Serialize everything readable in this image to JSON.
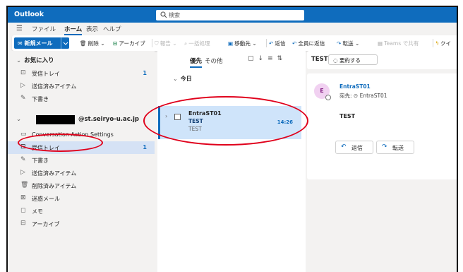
{
  "app": {
    "name": "Outlook"
  },
  "search": {
    "placeholder": "検索"
  },
  "menu": {
    "tabs": [
      {
        "label": "ファイル"
      },
      {
        "label": "ホーム"
      },
      {
        "label": "表示"
      },
      {
        "label": "ヘルプ"
      }
    ],
    "active_tab": "ホーム"
  },
  "ribbon": {
    "new_mail": "新規メール",
    "delete": "削除",
    "archive": "アーカイブ",
    "report": "報告",
    "sweep": "一括処理",
    "move_to": "移動先",
    "reply": "返信",
    "reply_all": "全員に返信",
    "forward": "転送",
    "teams_share": "Teams で共有",
    "quick_steps": "クイ"
  },
  "folders": {
    "favorites_header": "お気に入り",
    "favorites": [
      {
        "label": "受信トレイ",
        "count": "1"
      },
      {
        "label": "送信済みアイテム"
      },
      {
        "label": "下書き"
      }
    ],
    "account_suffix": "@st.seiryo-u.ac.jp",
    "account": [
      {
        "label": "Conversation Action Settings"
      },
      {
        "label": "受信トレイ",
        "count": "1"
      },
      {
        "label": "下書き"
      },
      {
        "label": "送信済みアイテム"
      },
      {
        "label": "削除済みアイテム"
      },
      {
        "label": "迷惑メール"
      },
      {
        "label": "メモ"
      },
      {
        "label": "アーカイブ"
      }
    ]
  },
  "message_list": {
    "tab_focused": "優先",
    "tab_other": "その他",
    "group_label": "今日",
    "messages": [
      {
        "sender": "EntraST01",
        "subject": "TEST",
        "preview": "TEST",
        "time": "14:26"
      }
    ]
  },
  "reading_pane": {
    "subject": "TEST",
    "summarize_label": "要約する",
    "avatar_initial": "E",
    "from": "EntraST01",
    "to_line": "宛先: ⊙ EntraST01",
    "body": "TEST",
    "reply_label": "返信",
    "forward_label": "転送"
  },
  "colors": {
    "brand": "#0f6cbd",
    "selection": "#cfe4fa",
    "annotation": "#e0001b"
  }
}
